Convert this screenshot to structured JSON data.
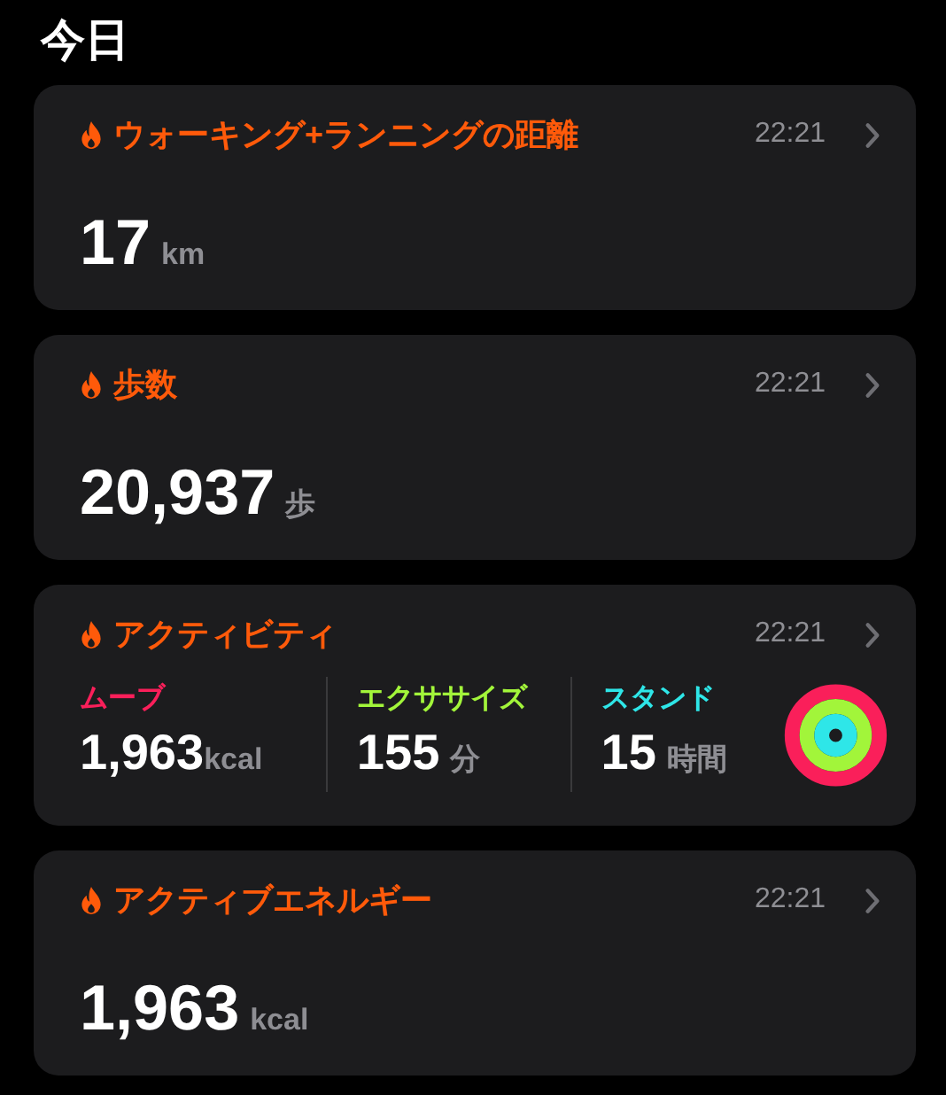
{
  "heading": "今日",
  "cards": [
    {
      "kind": "value",
      "title": "ウォーキング+ランニングの距離",
      "time": "22:21",
      "value": "17",
      "unit": "km"
    },
    {
      "kind": "value",
      "title": "歩数",
      "time": "22:21",
      "value": "20,937",
      "unit": "歩"
    },
    {
      "kind": "activity",
      "title": "アクティビティ",
      "time": "22:21",
      "metrics": [
        {
          "label": "ムーブ",
          "color": "#fa1f5a",
          "value": "1,963",
          "unit": "kcal"
        },
        {
          "label": "エクササイズ",
          "color": "#a2f53a",
          "value": "155",
          "unit": "分"
        },
        {
          "label": "スタンド",
          "color": "#2ee6e8",
          "value": "15",
          "unit": "時間"
        }
      ]
    },
    {
      "kind": "value",
      "title": "アクティブエネルギー",
      "time": "22:21",
      "value": "1,963",
      "unit": "kcal"
    }
  ]
}
